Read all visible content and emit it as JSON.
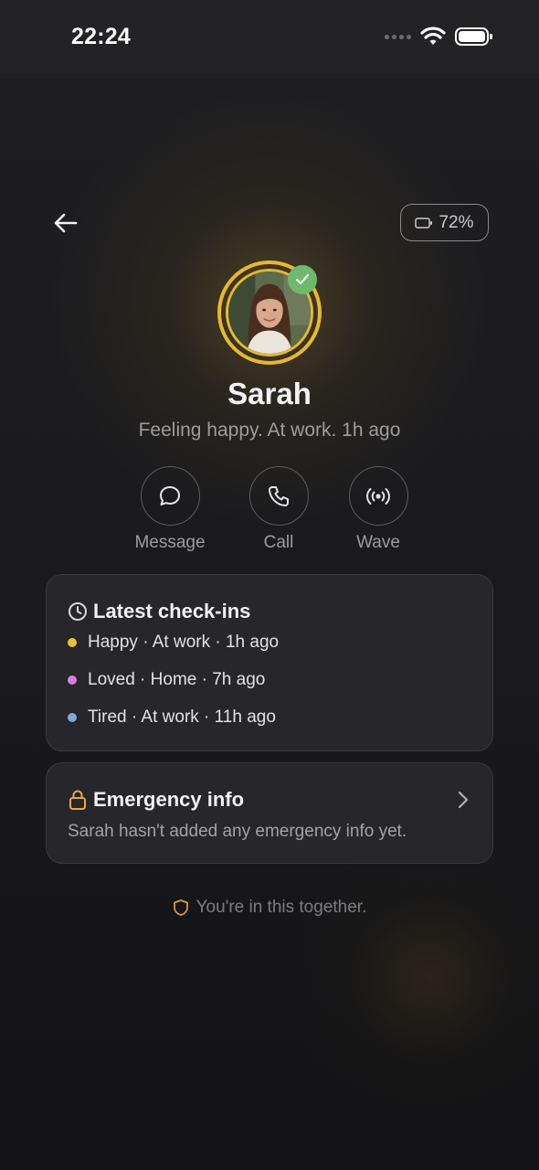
{
  "status_bar": {
    "time": "22:24"
  },
  "header": {
    "battery_label": "72%"
  },
  "profile": {
    "name": "Sarah",
    "status": "Feeling happy. At work. 1h ago"
  },
  "actions": [
    {
      "label": "Message",
      "icon": "chat-bubble-icon"
    },
    {
      "label": "Call",
      "icon": "phone-icon"
    },
    {
      "label": "Wave",
      "icon": "broadcast-icon"
    }
  ],
  "checkins": {
    "title": "Latest check-ins",
    "items": [
      {
        "text": "Happy · At work · 1h ago",
        "color": "#e6c23a"
      },
      {
        "text": "Loved · Home · 7h ago",
        "color": "#d77fd8"
      },
      {
        "text": "Tired · At work · 11h ago",
        "color": "#7fa9d4"
      }
    ]
  },
  "emergency": {
    "title": "Emergency info",
    "text": "Sarah hasn't added any emergency info yet."
  },
  "footer": {
    "text": "You're in this together."
  },
  "colors": {
    "accent": "#e6b92e",
    "online": "#6fb96b",
    "lock": "#e8a84a"
  }
}
